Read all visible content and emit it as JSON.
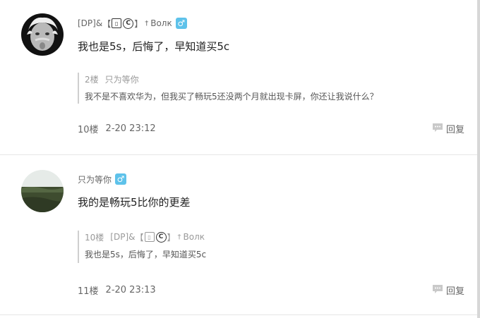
{
  "posts": [
    {
      "author_prefix": "[DP]&",
      "author_suffix": "Волк",
      "content": "我也是5s，后悔了，早知道买5c",
      "quote": {
        "floor": "2楼",
        "author": "只为等你",
        "text": "我不是不喜欢华为，但我买了畅玩5还没两个月就出现卡屏，你还让我说什么？"
      },
      "floor": "10楼",
      "time": "2-20 23:12",
      "reply_label": "回复"
    },
    {
      "author": "只为等你",
      "content": "我的是畅玩5比你的更差",
      "quote": {
        "floor": "10楼",
        "author_prefix": "[DP]&",
        "author_suffix": "Волк",
        "text": "我也是5s，后悔了，早知道买5c"
      },
      "floor": "11楼",
      "time": "2-20 23:13",
      "reply_label": "回复"
    }
  ],
  "colors": {
    "male_badge": "#5ec2ea",
    "divider": "#e6e6e6",
    "quote_border": "#cfcfcf"
  },
  "icons": [
    "male-icon",
    "reply-bubble-icon",
    "copyright-icon",
    "tag-icon",
    "cross-icon"
  ]
}
